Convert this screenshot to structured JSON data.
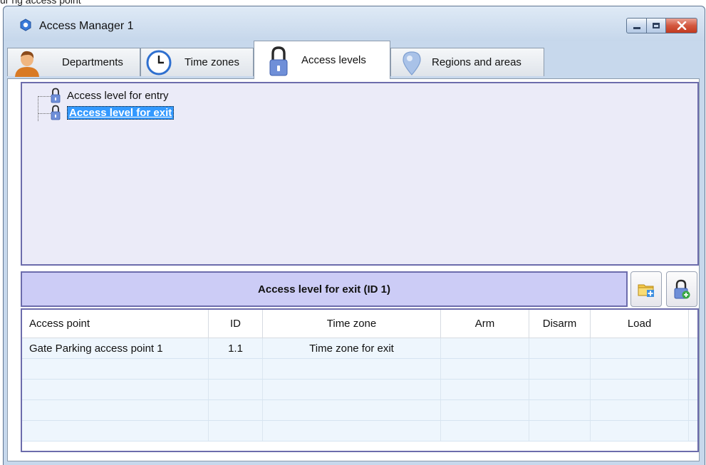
{
  "top_fragment": "ur ng access point",
  "window": {
    "title": "Access Manager 1"
  },
  "tabs": [
    {
      "label": "Departments",
      "icon": "person-icon"
    },
    {
      "label": "Time zones",
      "icon": "clock-icon"
    },
    {
      "label": "Access levels",
      "icon": "lock-icon",
      "active": true
    },
    {
      "label": "Regions and areas",
      "icon": "map-pin-icon"
    }
  ],
  "tree": {
    "items": [
      {
        "label": "Access level for entry",
        "selected": false
      },
      {
        "label": "Access level for exit",
        "selected": true
      }
    ]
  },
  "section": {
    "title": "Access level for exit (ID 1)"
  },
  "toolbar": {
    "add_folder_icon": "folder-add-icon",
    "add_lock_icon": "lock-add-icon"
  },
  "grid": {
    "columns": [
      "Access point",
      "ID",
      "Time zone",
      "Arm",
      "Disarm",
      "Load"
    ],
    "rows": [
      [
        "Gate Parking access point 1",
        "1.1",
        "Time zone for exit",
        "",
        "",
        ""
      ],
      [
        "",
        "",
        "",
        "",
        "",
        ""
      ],
      [
        "",
        "",
        "",
        "",
        "",
        ""
      ],
      [
        "",
        "",
        "",
        "",
        "",
        ""
      ],
      [
        "",
        "",
        "",
        "",
        "",
        ""
      ]
    ]
  },
  "colors": {
    "accent": "#3399ff",
    "panel_border": "#6c6cac",
    "header_bg": "#ccccf6",
    "tree_bg": "#ebebf8"
  }
}
